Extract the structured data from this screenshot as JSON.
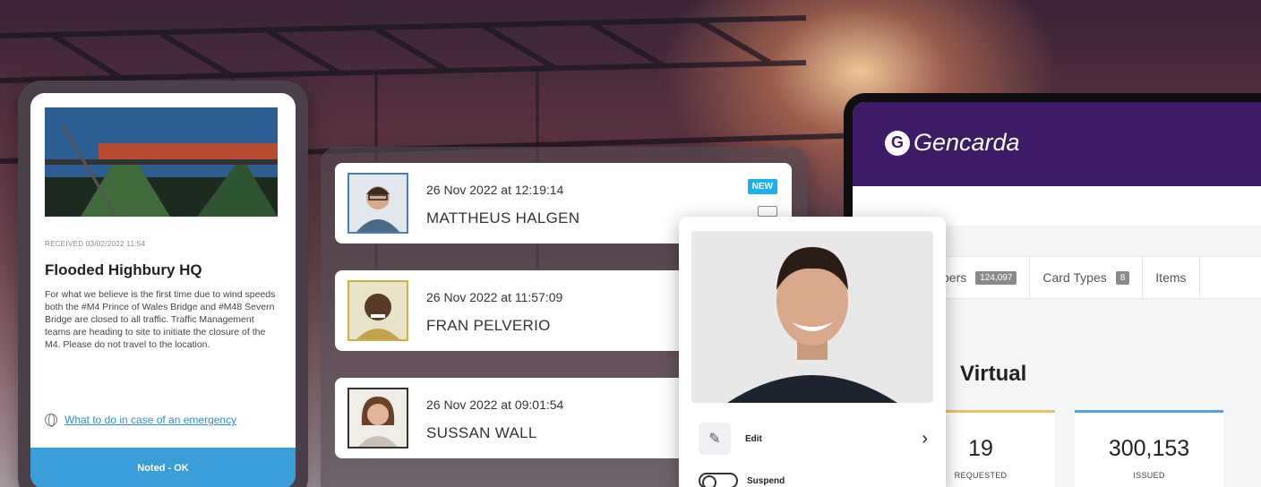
{
  "alert_phone": {
    "received": "RECEIVED 03/02/2022 11:54",
    "title": "Flooded Highbury HQ",
    "body": "For what we believe is the first time due to wind speeds both the #M4 Prince of Wales Bridge and #M48 Severn Bridge are closed to all traffic. Traffic Management teams are heading to site to initiate the closure of the M4. Please do not travel to the location.",
    "link": "What to do in case of an emergency",
    "button": "Noted - OK"
  },
  "activity": [
    {
      "timestamp": "26 Nov 2022 at 12:19:14",
      "name": "MATTHEUS HALGEN",
      "badge": "NEW"
    },
    {
      "timestamp": "26 Nov 2022 at 11:57:09",
      "name": "FRAN PELVERIO"
    },
    {
      "timestamp": "26 Nov 2022 at 09:01:54",
      "name": "SUSSAN WALL"
    }
  ],
  "member_card": {
    "edit_label": "Edit",
    "suspend_label": "Suspend"
  },
  "dashboard": {
    "brand": "Gencarda",
    "tabs": [
      {
        "label": "bers",
        "count": "124,097"
      },
      {
        "label": "Card Types",
        "count": "8"
      },
      {
        "label": "Items",
        "count": ""
      }
    ],
    "section_title": "Virtual",
    "stats": [
      {
        "value": "19",
        "label": "REQUESTED"
      },
      {
        "value": "300,153",
        "label": "ISSUED"
      }
    ]
  },
  "colors": {
    "brand_purple": "#3e1b67",
    "accent_blue": "#1ab1ee",
    "button_blue": "#3a9fd8"
  }
}
